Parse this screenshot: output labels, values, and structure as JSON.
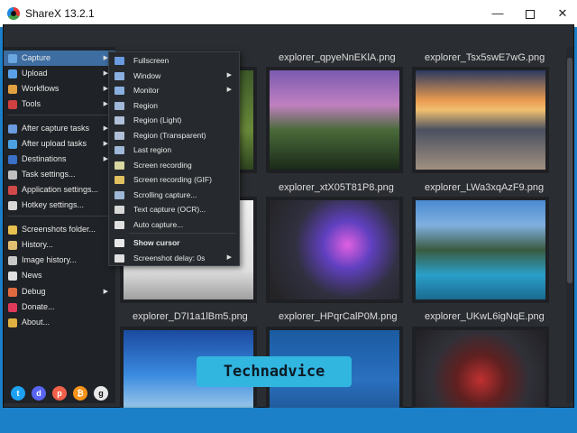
{
  "window": {
    "title": "ShareX 13.2.1"
  },
  "titlebar": {
    "minimize": "—",
    "close": "✕"
  },
  "sidebar": {
    "items": [
      {
        "label": "Capture",
        "icon": "camera-icon",
        "color": "#6aa6e0",
        "has_submenu": true,
        "active": true
      },
      {
        "label": "Upload",
        "icon": "upload-icon",
        "color": "#5aa0e8",
        "has_submenu": true
      },
      {
        "label": "Workflows",
        "icon": "workflows-icon",
        "color": "#e0a040",
        "has_submenu": true
      },
      {
        "label": "Tools",
        "icon": "tools-icon",
        "color": "#d04040",
        "has_submenu": true
      },
      {
        "label": "After capture tasks",
        "icon": "after-capture-icon",
        "color": "#6a9ae0",
        "has_submenu": true
      },
      {
        "label": "After upload tasks",
        "icon": "after-upload-icon",
        "color": "#4aa0e0",
        "has_submenu": true
      },
      {
        "label": "Destinations",
        "icon": "destinations-icon",
        "color": "#3a70c8",
        "has_submenu": true
      },
      {
        "label": "Task settings...",
        "icon": "gear-icon",
        "color": "#c0c0c0"
      },
      {
        "label": "Application settings...",
        "icon": "wrench-icon",
        "color": "#d04848"
      },
      {
        "label": "Hotkey settings...",
        "icon": "keyboard-icon",
        "color": "#d8d8d8"
      },
      {
        "label": "Screenshots folder...",
        "icon": "folder-icon",
        "color": "#e8c050"
      },
      {
        "label": "History...",
        "icon": "history-icon",
        "color": "#e0c070"
      },
      {
        "label": "Image history...",
        "icon": "image-history-icon",
        "color": "#c8c8c8"
      },
      {
        "label": "News",
        "icon": "news-icon",
        "color": "#e0e0e0"
      },
      {
        "label": "Debug",
        "icon": "debug-icon",
        "color": "#e06a40",
        "has_submenu": true
      },
      {
        "label": "Donate...",
        "icon": "heart-icon",
        "color": "#e03a5a"
      },
      {
        "label": "About...",
        "icon": "about-icon",
        "color": "#e0b040"
      }
    ],
    "social": [
      {
        "name": "twitter-icon",
        "glyph": "t",
        "color": "#1da1f2"
      },
      {
        "name": "discord-icon",
        "glyph": "d",
        "color": "#5865f2"
      },
      {
        "name": "patreon-icon",
        "glyph": "p",
        "color": "#f0604a"
      },
      {
        "name": "bitcoin-icon",
        "glyph": "₿",
        "color": "#f7931a"
      },
      {
        "name": "github-icon",
        "glyph": "g",
        "color": "#e8e8e8"
      }
    ]
  },
  "submenu": {
    "items": [
      {
        "label": "Fullscreen",
        "icon": "fullscreen-icon",
        "color": "#6a9ae0"
      },
      {
        "label": "Window",
        "icon": "window-icon",
        "color": "#8ab0e0",
        "has_submenu": true
      },
      {
        "label": "Monitor",
        "icon": "monitor-icon",
        "color": "#8ab0e0",
        "has_submenu": true
      },
      {
        "label": "Region",
        "icon": "region-icon",
        "color": "#a0b8d8"
      },
      {
        "label": "Region (Light)",
        "icon": "region-light-icon",
        "color": "#b0c0d8"
      },
      {
        "label": "Region (Transparent)",
        "icon": "region-transparent-icon",
        "color": "#b0c0d8"
      },
      {
        "label": "Last region",
        "icon": "last-region-icon",
        "color": "#a0b8d8"
      },
      {
        "label": "Screen recording",
        "icon": "screen-recording-icon",
        "color": "#d8d8a0"
      },
      {
        "label": "Screen recording (GIF)",
        "icon": "gif-recording-icon",
        "color": "#e0c060"
      },
      {
        "label": "Scrolling capture...",
        "icon": "scrolling-capture-icon",
        "color": "#a0b8d8"
      },
      {
        "label": "Text capture (OCR)...",
        "icon": "ocr-icon",
        "color": "#d8d8d8"
      },
      {
        "label": "Auto capture...",
        "icon": "clock-icon",
        "color": "#e0e0e0"
      },
      {
        "label": "Show cursor",
        "icon": "cursor-icon",
        "color": "#e8e8e8",
        "bold": true
      },
      {
        "label": "Screenshot delay: 0s",
        "icon": "delay-icon",
        "color": "#e0e0e0",
        "has_submenu": true
      }
    ]
  },
  "thumbnails": [
    {
      "label": ".png",
      "img": "linear-gradient(180deg,#3d5a2a 0%,#6a8a3a 60%,#2e4420 100%)"
    },
    {
      "label": "explorer_qpyeNnEKlA.png",
      "img": "linear-gradient(180deg,#7a5ab0 0%,#c080c0 35%,#4a6a3a 60%,#1a2a18 100%)"
    },
    {
      "label": "explorer_Tsx5swE7wG.png",
      "img": "linear-gradient(180deg,#2a3a60 0%,#e89a50 30%,#f0c070 40%,#4a5060 60%,#a09080 100%)"
    },
    {
      "label": ".png",
      "img": "linear-gradient(180deg,#f0f0f0 0%,#e0e0e0 70%,#a0a0a0 100%)"
    },
    {
      "label": "explorer_xtX05T81P8.png",
      "img": "radial-gradient(circle at 60% 45%,#e060e0 0%,#6040c0 25%,#303040 55%,#222 100%)"
    },
    {
      "label": "explorer_LWa3xqAzF9.png",
      "img": "linear-gradient(180deg,#4a8ad0 0%,#80b0e0 25%,#3a5a40 50%,#2aa0c8 75%,#1a6a90 100%)"
    },
    {
      "label": "explorer_D7I1a1lBm5.png",
      "img": "linear-gradient(180deg,#1a4aa0 0%,#3a8ae0 45%,#90c0e8 75%,#2a7a30 100%)"
    },
    {
      "label": "explorer_HPqrCalP0M.png",
      "img": "linear-gradient(180deg,#1a5aa0 0%,#2a70c0 50%,#1a4a80 100%)"
    },
    {
      "label": "explorer_UKwL6igNqE.png",
      "img": "radial-gradient(circle at 50% 50%,#c03030 0%,#602020 30%,#303038 60%,#202024 100%)"
    }
  ],
  "watermark": "Technadvice"
}
